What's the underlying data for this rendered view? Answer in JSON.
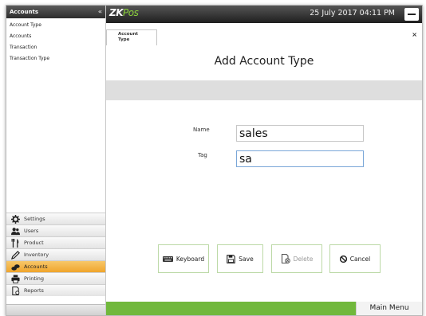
{
  "sidebar": {
    "header": "Accounts",
    "collapse": "«",
    "items": [
      {
        "label": "Account Type"
      },
      {
        "label": "Accounts"
      },
      {
        "label": "Transaction"
      },
      {
        "label": "Transaction Type"
      }
    ],
    "nav": [
      {
        "label": "Settings",
        "icon": "gear-icon"
      },
      {
        "label": "Users",
        "icon": "users-icon"
      },
      {
        "label": "Product",
        "icon": "fork-knife-icon"
      },
      {
        "label": "Inventory",
        "icon": "pencil-icon"
      },
      {
        "label": "Accounts",
        "icon": "coins-icon",
        "active": true
      },
      {
        "label": "Printing",
        "icon": "printer-icon"
      },
      {
        "label": "Reports",
        "icon": "report-icon"
      }
    ]
  },
  "topbar": {
    "logo_zk": "ZK",
    "logo_pos": "Pos",
    "datetime": "25 July 2017 04:11 PM"
  },
  "tab": {
    "line1": "Account",
    "line2": "Type"
  },
  "close": "×",
  "page_title": "Add Account Type",
  "form": {
    "name_label": "Name",
    "name_value": "sales",
    "tag_label": "Tag",
    "tag_value": "sa"
  },
  "buttons": {
    "keyboard": "Keyboard",
    "save": "Save",
    "delete": "Delete",
    "cancel": "Cancel"
  },
  "main_menu": "Main Menu",
  "colors": {
    "accent_green": "#71b83c",
    "active_nav": "#f0a52c"
  }
}
